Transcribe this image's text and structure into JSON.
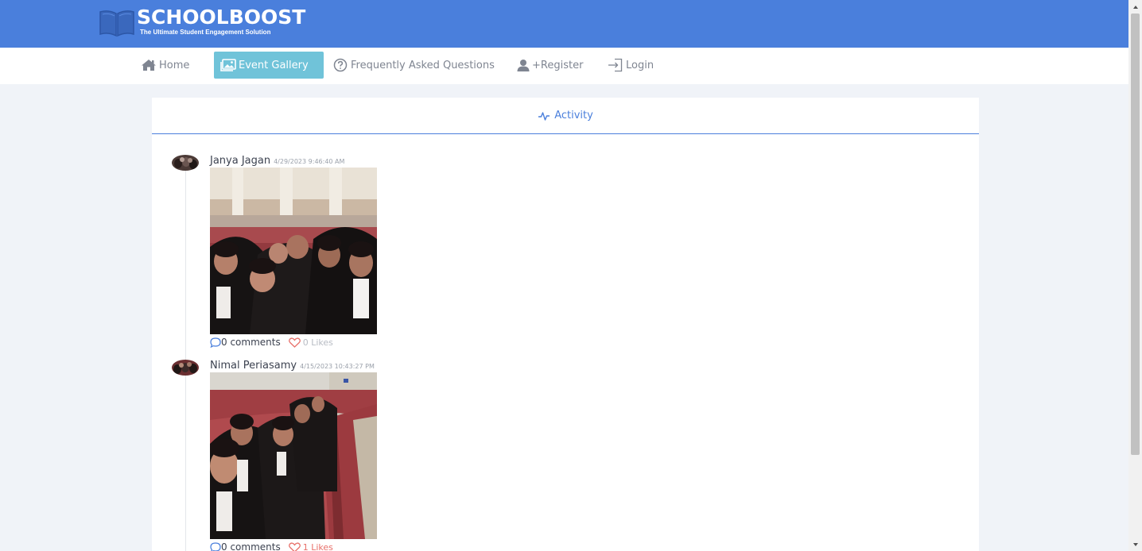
{
  "brand": {
    "title": "SCHOOLBOOST",
    "tagline": "The Ultimate Student Engagement Solution"
  },
  "nav": {
    "home": "Home",
    "gallery": "Event Gallery",
    "faq": "Frequently Asked Questions",
    "register": "+Register",
    "login": "Login"
  },
  "activity": {
    "title": "Activity"
  },
  "posts": [
    {
      "author": "Janya Jagan",
      "timestamp": "4/29/2023 9:46:40 AM",
      "comments": "0 comments",
      "likes": "0 Likes"
    },
    {
      "author": "Nimal Periasamy",
      "timestamp": "4/15/2023 10:43:27 PM",
      "comments": "0 comments",
      "likes": "1 Likes"
    }
  ],
  "colors": {
    "header_blue": "#4a7fdc",
    "active_tab": "#70c3d9",
    "like_red": "#e8716b"
  }
}
